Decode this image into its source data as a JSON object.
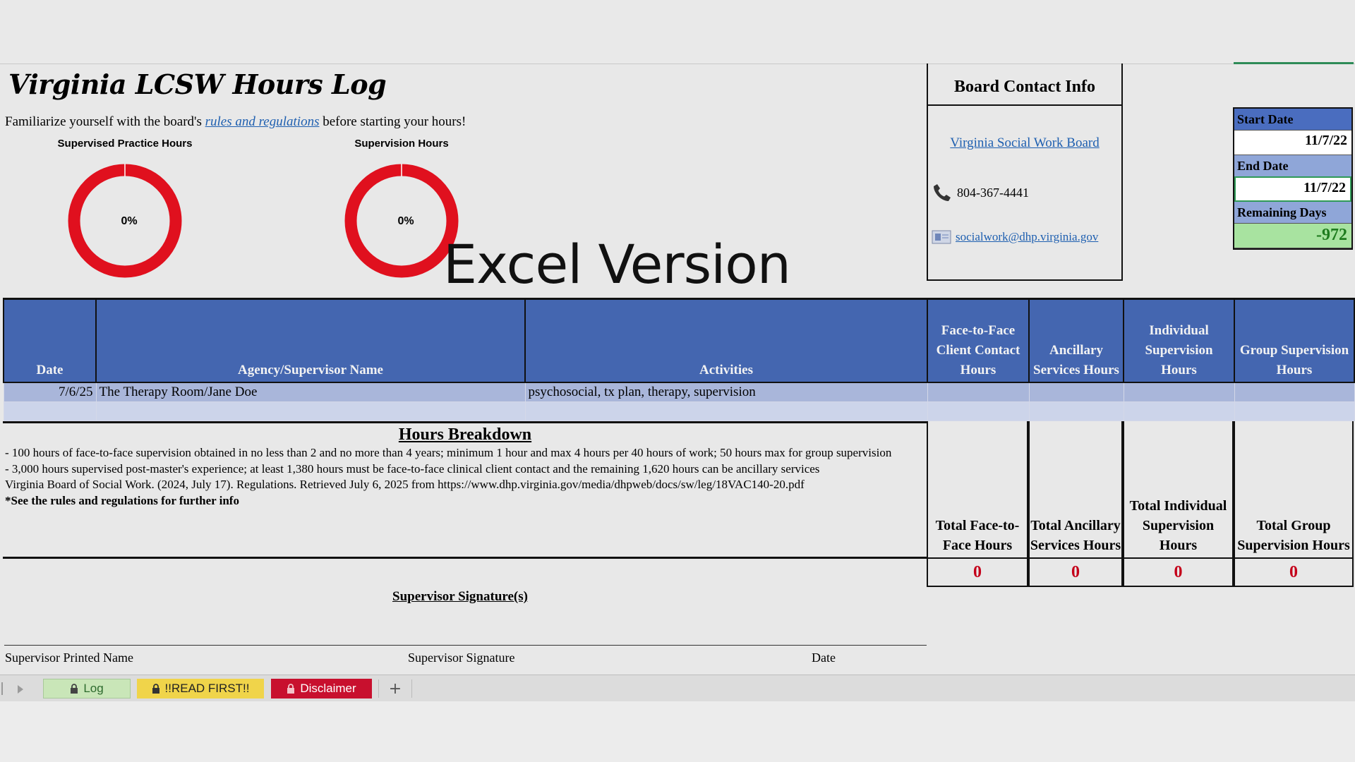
{
  "title": "Virginia LCSW Hours Log",
  "intro": {
    "before": "Familiarize yourself with the board's ",
    "link": "rules and regulations",
    "after": " before starting your hours!"
  },
  "donuts": [
    {
      "label": "Supervised Practice Hours",
      "value": "0%",
      "percent": 0
    },
    {
      "label": "Supervision Hours",
      "value": "0%",
      "percent": 0
    }
  ],
  "watermark": "Excel Version",
  "contact": {
    "title": "Board Contact Info",
    "board_link": "Virginia Social Work Board",
    "phone": "804-367-4441",
    "email": "socialwork@dhp.virginia.gov",
    "phone_icon": "phone-icon",
    "email_icon": "email-icon"
  },
  "dates": {
    "start_label": "Start Date",
    "start_value": "11/7/22",
    "end_label": "End Date",
    "end_value": "11/7/22",
    "remaining_label": "Remaining Days",
    "remaining_value": "-972"
  },
  "table": {
    "headers": [
      "Date",
      "Agency/Supervisor Name",
      "Activities",
      "Face-to-Face Client Contact Hours",
      "Ancillary Services Hours",
      "Individual Supervision Hours",
      "Group Supervision Hours"
    ],
    "rows": [
      [
        "7/6/25",
        "The Therapy Room/Jane Doe",
        "psychosocial, tx plan, therapy, supervision",
        "",
        "",
        "",
        ""
      ],
      [
        "",
        "",
        "",
        "",
        "",
        "",
        ""
      ]
    ]
  },
  "breakdown": {
    "title": "Hours Breakdown",
    "lines": [
      "- 100 hours of face-to-face supervision obtained in no less than 2 and no more than 4 years; minimum 1 hour and max 4 hours per 40 hours of work; 50 hours max for group supervision",
      "- 3,000 hours supervised post-master's experience; at least 1,380 hours must be face-to-face clinical client contact and the remaining 1,620 hours can be ancillary services",
      "Virginia Board of Social Work. (2024, July 17). Regulations. Retrieved July 6, 2025 from https://www.dhp.virginia.gov/media/dhpweb/docs/sw/leg/18VAC140-20.pdf"
    ],
    "note": "*See the rules and regulations for further info"
  },
  "totals": {
    "labels": [
      "Total Face-to-Face Hours",
      "Total Ancillary Services Hours",
      "Total Individual Supervision Hours",
      "Total Group Supervision Hours"
    ],
    "values": [
      "0",
      "0",
      "0",
      "0"
    ]
  },
  "signature": {
    "title": "Supervisor Signature(s)",
    "printed_name": "Supervisor Printed Name",
    "signature": "Supervisor Signature",
    "date": "Date"
  },
  "tabs": [
    {
      "label": "Log",
      "color": "#c9e6b8",
      "text_color": "#2d6a2d"
    },
    {
      "label": "!!READ FIRST!!",
      "color": "#f0d44a",
      "text_color": "#222222"
    },
    {
      "label": "Disclaimer",
      "color": "#c8102e",
      "text_color": "#ffffff"
    }
  ],
  "colors": {
    "header_blue": "#4466b0",
    "donut_red": "#e0101e",
    "total_red": "#c4001a"
  }
}
